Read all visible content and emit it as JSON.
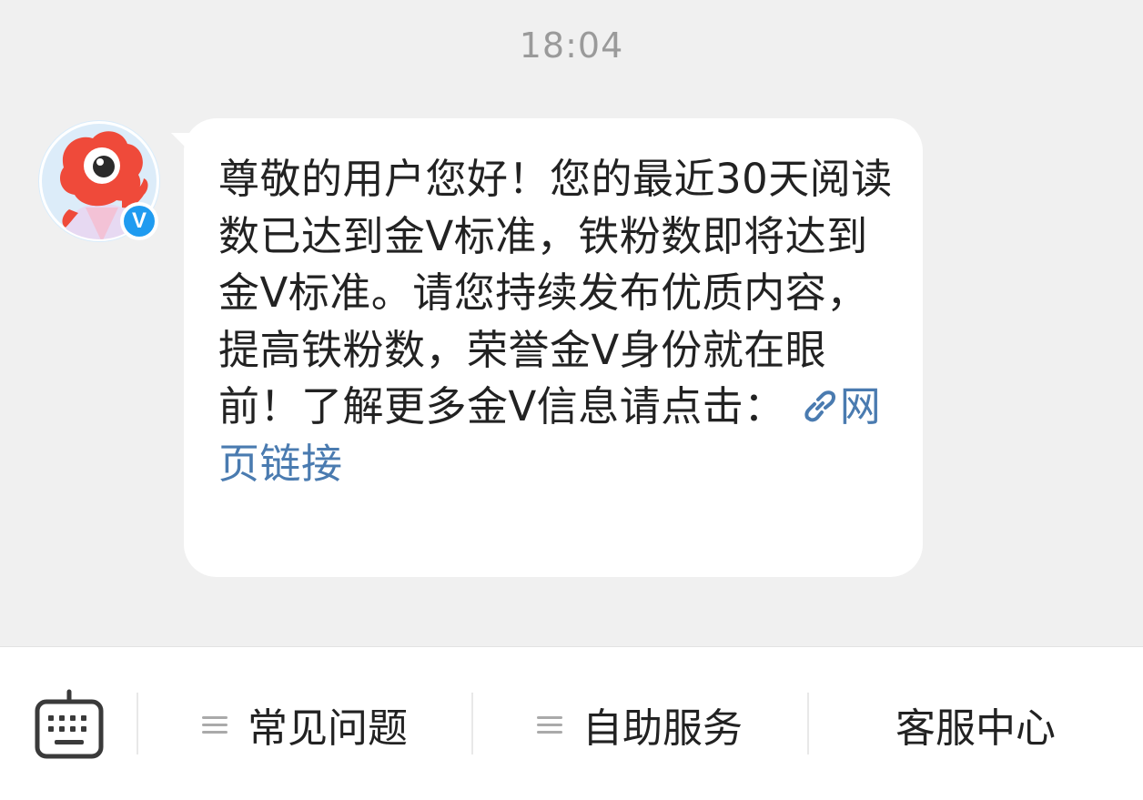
{
  "chat": {
    "timestamp": "18:04",
    "message": {
      "text": "尊敬的用户您好！您的最近30天阅读数已达到金V标准，铁粉数即将达到金V标准。请您持续发布优质内容，提高铁粉数，荣誉金V身份就在眼前！了解更多金V信息请点击：",
      "link_label": "网页链接"
    },
    "avatar": {
      "verified_badge": "V"
    }
  },
  "bottom_bar": {
    "items": [
      {
        "label": "常见问题",
        "has_menu_icon": true
      },
      {
        "label": "自助服务",
        "has_menu_icon": true
      },
      {
        "label": "客服中心",
        "has_menu_icon": false
      }
    ]
  },
  "colors": {
    "background": "#f0f0f0",
    "bubble": "#ffffff",
    "link": "#4a7bb0",
    "verified": "#1f9bf0"
  },
  "icons": [
    "keyboard-icon",
    "menu-lines-icon",
    "link-icon",
    "verified-icon"
  ]
}
